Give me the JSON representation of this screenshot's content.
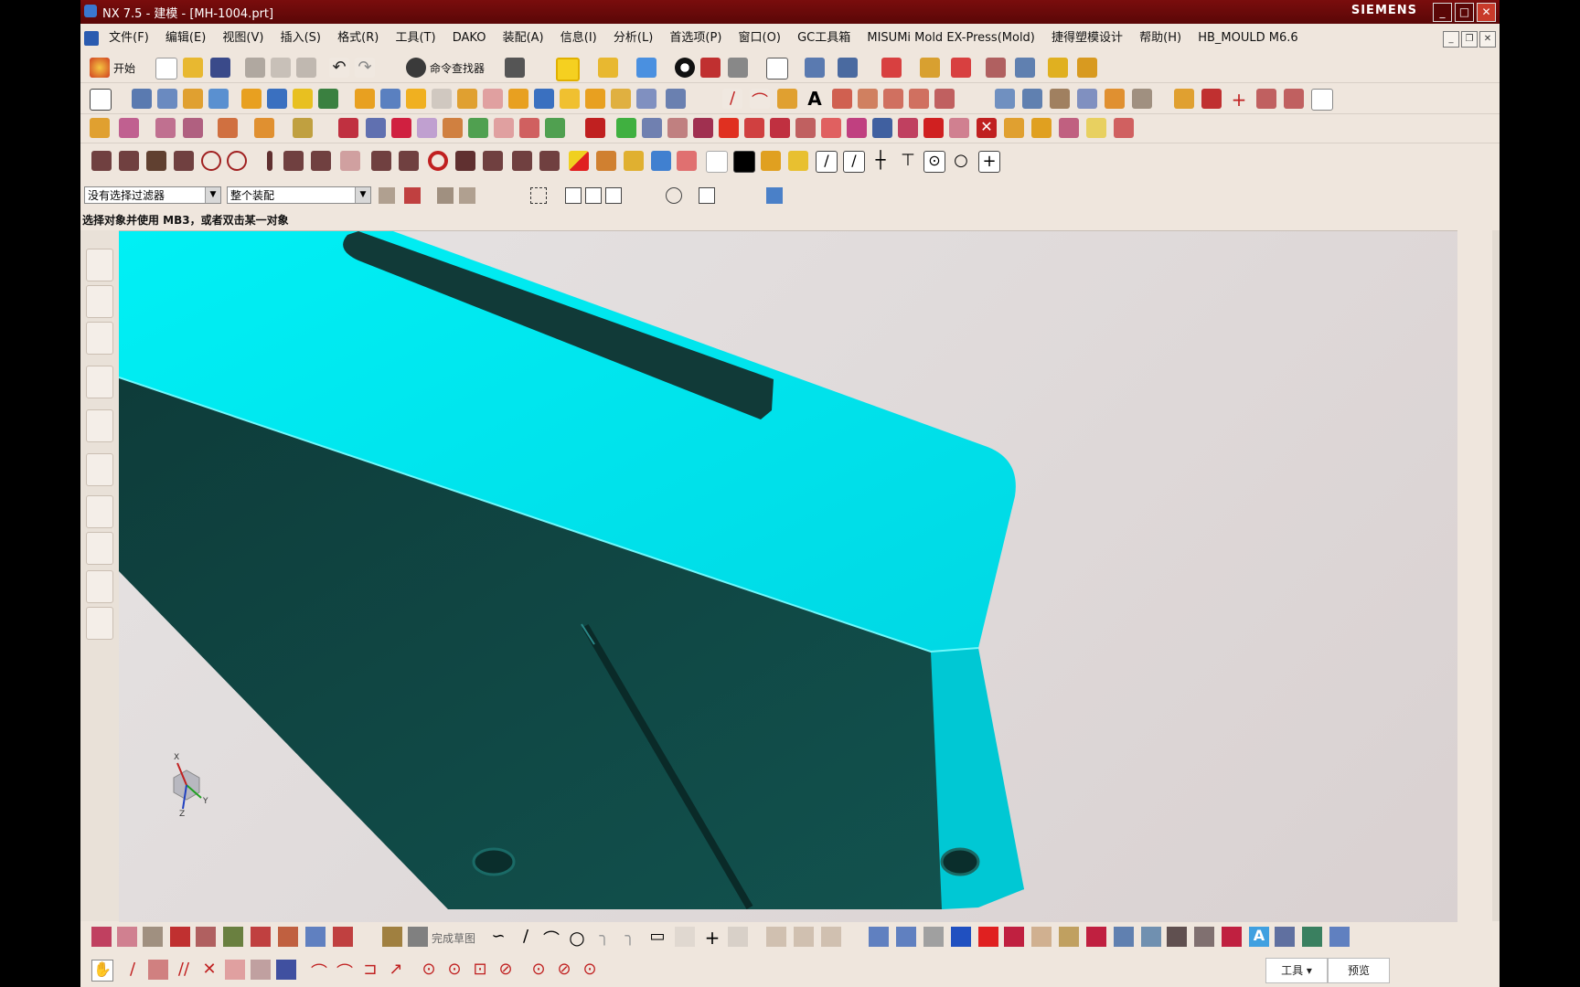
{
  "window": {
    "title": "NX 7.5 - 建模 - [MH-1004.prt]",
    "brand": "SIEMENS",
    "controls": [
      "_",
      "□",
      "✕"
    ]
  },
  "menu": {
    "items": [
      "文件(F)",
      "编辑(E)",
      "视图(V)",
      "插入(S)",
      "格式(R)",
      "工具(T)",
      "DAKO",
      "装配(A)",
      "信息(I)",
      "分析(L)",
      "首选项(P)",
      "窗口(O)",
      "GC工具箱",
      "MISUMi Mold EX-Press(Mold)",
      "捷得塑模设计",
      "帮助(H)",
      "HB_MOULD M6.6"
    ]
  },
  "toolbar": {
    "start_label": "开始",
    "command_finder_label": "命令查找器"
  },
  "filters": {
    "type_filter": "没有选择过滤器",
    "scope_filter": "整个装配"
  },
  "status": {
    "prompt": "选择对象并使用 MB3，或者双击某一对象"
  },
  "sketch": {
    "finish_label": "完成草图"
  },
  "bottom": {
    "tools_label": "工具",
    "preview_label": "预览"
  },
  "triad": {
    "x": "X",
    "y": "Y",
    "z": "Z"
  },
  "colors": {
    "part_light": "#00e5ee",
    "part_dark": "#0f4a48",
    "titlebar": "#7a0d0d"
  }
}
